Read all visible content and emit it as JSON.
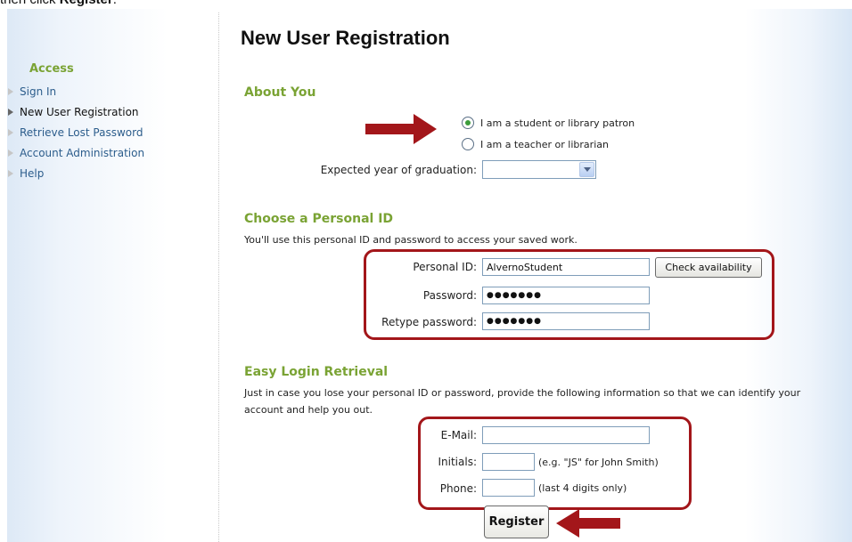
{
  "caption": {
    "prefix": "then click ",
    "bold": "Register",
    "suffix": "."
  },
  "page_title": "New User Registration",
  "sidebar": {
    "heading": "Access",
    "items": [
      {
        "label": "Sign In"
      },
      {
        "label": "New User Registration"
      },
      {
        "label": "Retrieve Lost Password"
      },
      {
        "label": "Account Administration"
      },
      {
        "label": "Help"
      }
    ]
  },
  "about_you": {
    "title": "About You",
    "radio_student": "I am a student or library patron",
    "radio_teacher": "I am a teacher or librarian",
    "selected": "student",
    "grad_label": "Expected year of graduation:",
    "grad_value": ""
  },
  "personal_id": {
    "title": "Choose a Personal ID",
    "desc": "You'll use this personal ID and password to access your saved work.",
    "id_label": "Personal ID:",
    "id_value": "AlvernoStudent",
    "check_button": "Check availability",
    "password_label": "Password:",
    "password_value": "●●●●●●●",
    "retype_label": "Retype password:",
    "retype_value": "●●●●●●●"
  },
  "retrieval": {
    "title": "Easy Login Retrieval",
    "desc_line1": "Just in case you lose your personal ID or password, provide the following information so that we can identify your",
    "desc_line2": "account and help you out.",
    "email_label": "E-Mail:",
    "email_value": "",
    "initials_label": "Initials:",
    "initials_value": "",
    "initials_hint": "(e.g. \"JS\" for John Smith)",
    "phone_label": "Phone:",
    "phone_value": "",
    "phone_hint": "(last 4 digits only)"
  },
  "register_button": "Register",
  "colors": {
    "accent_green": "#7aa334",
    "link_blue": "#2c5d8c",
    "callout_red": "#a3161a"
  }
}
